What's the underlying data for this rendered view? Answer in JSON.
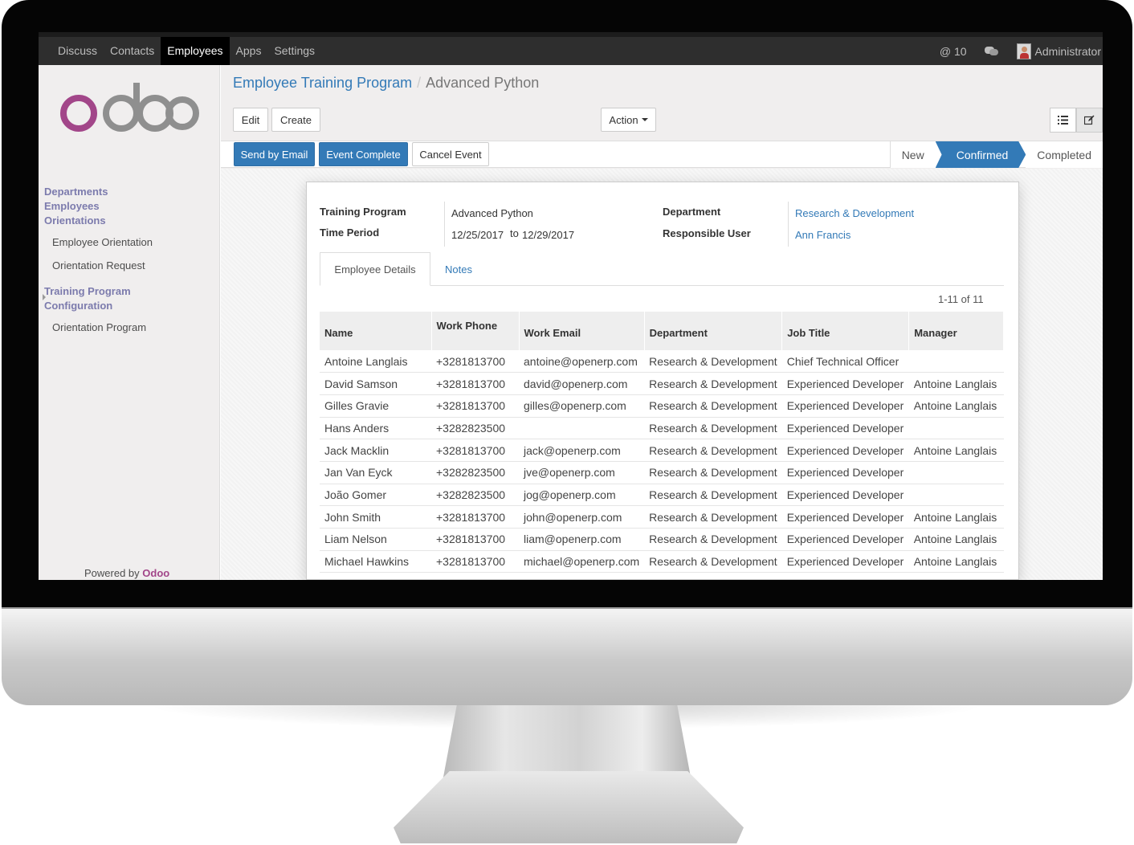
{
  "nav": {
    "items": [
      {
        "label": "Discuss",
        "active": false
      },
      {
        "label": "Contacts",
        "active": false
      },
      {
        "label": "Employees",
        "active": true
      },
      {
        "label": "Apps",
        "active": false
      },
      {
        "label": "Settings",
        "active": false
      }
    ],
    "mentions_count": "@ 10",
    "user": "Administrator"
  },
  "sidebar": {
    "logo": "odoo",
    "sections": {
      "departments": "Departments",
      "employees": "Employees",
      "orientations": "Orientations",
      "employee_orientation": "Employee Orientation",
      "orientation_request": "Orientation Request",
      "training_program": "Training Program",
      "configuration": "Configuration",
      "orientation_program": "Orientation Program"
    },
    "powered_by": "Powered by",
    "powered_brand": "Odoo"
  },
  "breadcrumb": {
    "parent": "Employee Training Program",
    "separator": "/",
    "current": "Advanced Python"
  },
  "toolbar": {
    "edit": "Edit",
    "create": "Create",
    "action": "Action"
  },
  "statusbar": {
    "send_by_email": "Send by Email",
    "event_complete": "Event Complete",
    "cancel_event": "Cancel Event",
    "stages": [
      "New",
      "Confirmed",
      "Completed"
    ],
    "current_stage": "Confirmed"
  },
  "form": {
    "training_program_label": "Training Program",
    "training_program_value": "Advanced Python",
    "time_period_label": "Time Period",
    "date_from": "12/25/2017",
    "to_label": "to",
    "date_to": "12/29/2017",
    "department_label": "Department",
    "department_value": "Research & Development",
    "responsible_label": "Responsible User",
    "responsible_value": "Ann Francis"
  },
  "tabs": {
    "employee_details": "Employee Details",
    "notes": "Notes"
  },
  "pager": "1-11 of 11",
  "table": {
    "headers": [
      "Name",
      "Work Phone",
      "Work Email",
      "Department",
      "Job Title",
      "Manager"
    ],
    "rows": [
      [
        "Antoine Langlais",
        "+3281813700",
        "antoine@openerp.com",
        "Research & Development",
        "Chief Technical Officer",
        ""
      ],
      [
        "David Samson",
        "+3281813700",
        "david@openerp.com",
        "Research & Development",
        "Experienced Developer",
        "Antoine Langlais"
      ],
      [
        "Gilles Gravie",
        "+3281813700",
        "gilles@openerp.com",
        "Research & Development",
        "Experienced Developer",
        "Antoine Langlais"
      ],
      [
        "Hans Anders",
        "+3282823500",
        "",
        "Research & Development",
        "Experienced Developer",
        ""
      ],
      [
        "Jack Macklin",
        "+3281813700",
        "jack@openerp.com",
        "Research & Development",
        "Experienced Developer",
        "Antoine Langlais"
      ],
      [
        "Jan Van Eyck",
        "+3282823500",
        "jve@openerp.com",
        "Research & Development",
        "Experienced Developer",
        ""
      ],
      [
        "João Gomer",
        "+3282823500",
        "jog@openerp.com",
        "Research & Development",
        "Experienced Developer",
        ""
      ],
      [
        "John Smith",
        "+3281813700",
        "john@openerp.com",
        "Research & Development",
        "Experienced Developer",
        "Antoine Langlais"
      ],
      [
        "Liam Nelson",
        "+3281813700",
        "liam@openerp.com",
        "Research & Development",
        "Experienced Developer",
        "Antoine Langlais"
      ],
      [
        "Michael Hawkins",
        "+3281813700",
        "michael@openerp.com",
        "Research & Development",
        "Experienced Developer",
        "Antoine Langlais"
      ]
    ]
  },
  "colors": {
    "brand_purple": "#7c7bad",
    "odoo_magenta": "#a24689",
    "primary_blue": "#337ab7",
    "topbar": "#2e2e2e"
  },
  "icons": {
    "mentions": "at-icon",
    "chat": "chat-icon",
    "list_view": "list-icon",
    "form_view": "edit-icon"
  }
}
